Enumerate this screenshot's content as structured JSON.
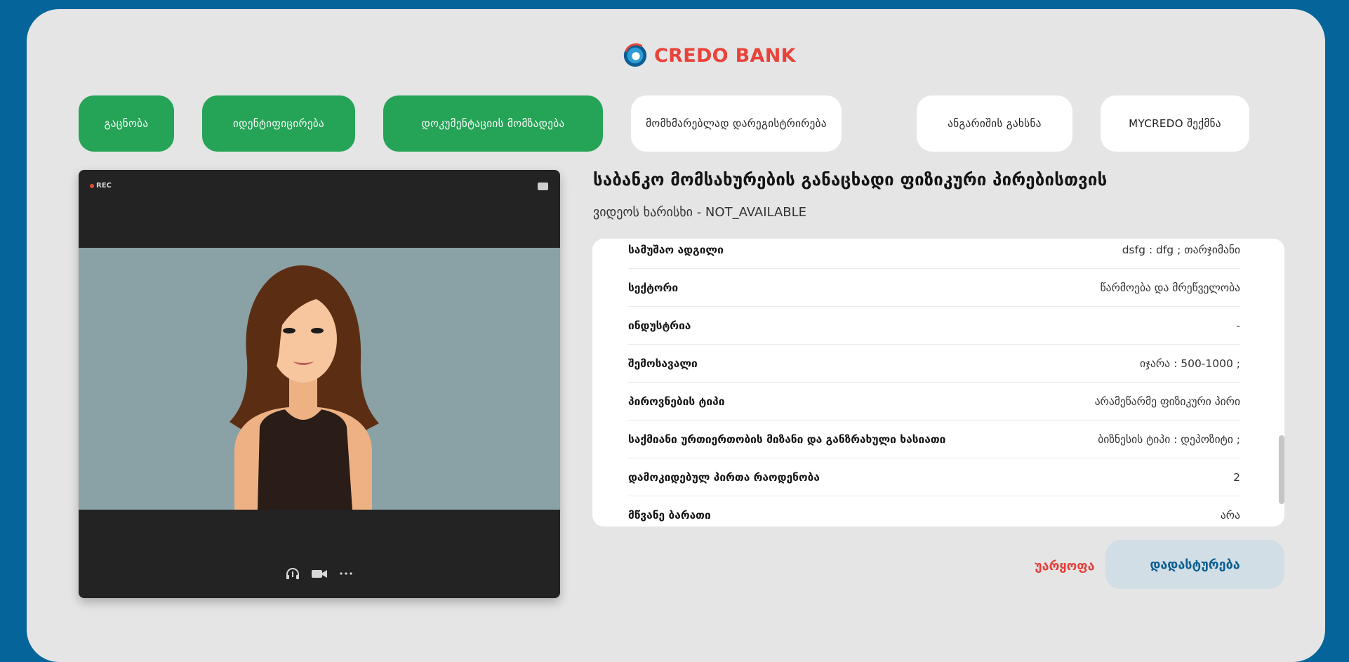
{
  "brand": {
    "name": "CREDO BANK",
    "accent": "#e8433a",
    "primary": "#05659a"
  },
  "steps": [
    {
      "label": "გაცნობა",
      "state": "done"
    },
    {
      "label": "იდენტიფიცირება",
      "state": "done"
    },
    {
      "label": "დოკუმენტაციის მომზადება",
      "state": "done"
    },
    {
      "label": "მომხმარებლად დარეგისტრირება",
      "state": "todo"
    },
    {
      "label": "ანგარიშის გახსნა",
      "state": "todo"
    },
    {
      "label": "MYCREDO შექმნა",
      "state": "todo"
    }
  ],
  "video": {
    "rec_label": "REC",
    "icons": [
      "headset-icon",
      "camera-icon",
      "more-icon"
    ]
  },
  "form": {
    "title": "საბანკო მომსახურების განაცხადი ფიზიკური პირებისთვის",
    "quality": "ვიდეოს ხარისხი - NOT_AVAILABLE",
    "rows": [
      {
        "label": "სამუშაო ადგილი",
        "value": "dsfg : dfg ; თარჯიმანი"
      },
      {
        "label": "სექტორი",
        "value": "წარმოება და მრეწველობა"
      },
      {
        "label": "ინდუსტრია",
        "value": "-"
      },
      {
        "label": "შემოსავალი",
        "value": "იჯარა : 500-1000 ;"
      },
      {
        "label": "პიროვნების ტიპი",
        "value": "არამეწარმე ფიზიკური პირი"
      },
      {
        "label": "საქმიანი ურთიერთობის მიზანი და განზრახული ხასიათი",
        "value": "ბიზნესის ტიპი : დეპოზიტი ;"
      },
      {
        "label": "დამოკიდებულ პირთა რაოდენობა",
        "value": "2"
      },
      {
        "label": "მწვანე ბარათი",
        "value": "არა"
      }
    ]
  },
  "actions": {
    "reject": "უარყოფა",
    "confirm": "დადასტურება"
  }
}
